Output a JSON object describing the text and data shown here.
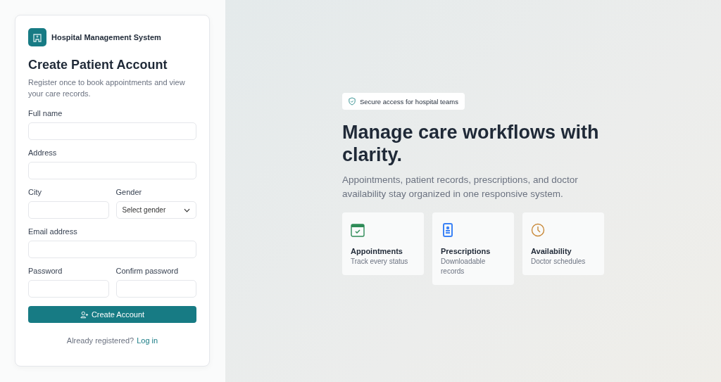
{
  "brand": {
    "name": "Hospital Management System"
  },
  "form": {
    "title": "Create Patient Account",
    "subtitle": "Register once to book appointments and view your care records.",
    "rows": [
      [
        {
          "label": "Full name",
          "kind": "text"
        }
      ],
      [
        {
          "label": "Address",
          "kind": "text"
        }
      ],
      [
        {
          "label": "City",
          "kind": "text"
        },
        {
          "label": "Gender",
          "kind": "select",
          "value": "Select gender"
        }
      ],
      [
        {
          "label": "Email address",
          "kind": "text"
        }
      ],
      [
        {
          "label": "Password",
          "kind": "text"
        },
        {
          "label": "Confirm password",
          "kind": "text"
        }
      ]
    ],
    "submit": "Create Account",
    "footer_text": "Already registered?",
    "footer_link": "Log in"
  },
  "hero": {
    "badge": "Secure access for hospital teams",
    "title": "Manage care workflows with clarity.",
    "text": "Appointments, patient records, prescriptions, and doctor availability stay organized in one responsive system.",
    "features": [
      {
        "kind": "calendar",
        "color": "#2e8b57",
        "title": "Appointments",
        "text": "Track every status"
      },
      {
        "kind": "document",
        "color": "#3b82f6",
        "title": "Prescriptions",
        "text": "Downloadable records"
      },
      {
        "kind": "clock",
        "color": "#c98a3a",
        "title": "Availability",
        "text": "Doctor schedules"
      }
    ]
  }
}
